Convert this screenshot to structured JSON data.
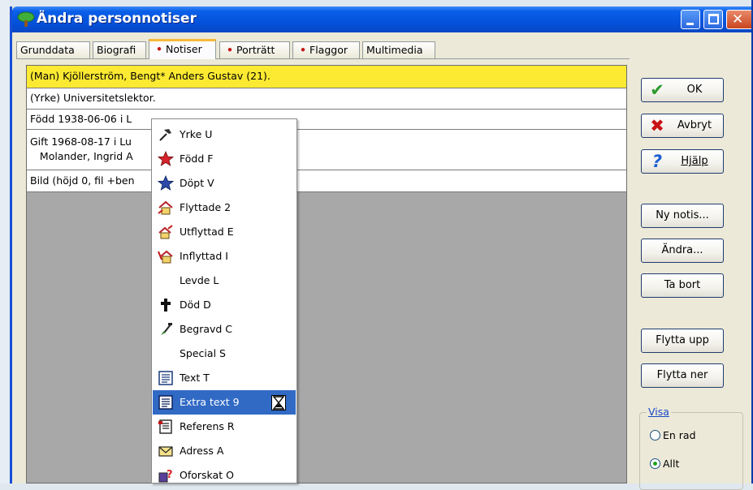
{
  "window": {
    "title": "Ändra personnotiser"
  },
  "tabs": [
    {
      "label": "Grunddata",
      "dot": false
    },
    {
      "label": "Biografi",
      "dot": false
    },
    {
      "label": "Notiser",
      "dot": true
    },
    {
      "label": "Porträtt",
      "dot": true
    },
    {
      "label": "Flaggor",
      "dot": true
    },
    {
      "label": "Multimedia",
      "dot": false
    }
  ],
  "active_tab": "Notiser",
  "notes": [
    {
      "text": "(Man) Kjöllerström, Bengt* Anders Gustav (21).",
      "selected": true
    },
    {
      "text": "(Yrke) Universitetslektor.",
      "selected": false
    },
    {
      "text": "Född 1938-06-06 i L",
      "selected": false
    },
    {
      "text": "Gift 1968-08-17 i Lu",
      "line2": "   Molander, Ingrid A",
      "selected": false
    },
    {
      "text": "Bild (höjd 0, fil +ben",
      "selected": false
    }
  ],
  "context_menu": {
    "items": [
      {
        "label": "Yrke U",
        "icon": "hammer-icon"
      },
      {
        "label": "Född F",
        "icon": "red-star-icon"
      },
      {
        "label": "Döpt V",
        "icon": "blue-star-icon"
      },
      {
        "label": "Flyttade 2",
        "icon": "house-move-icon"
      },
      {
        "label": "Utflyttad E",
        "icon": "house-out-icon"
      },
      {
        "label": "Inflyttad I",
        "icon": "house-in-icon"
      },
      {
        "label": "Levde L",
        "icon": ""
      },
      {
        "label": "Död D",
        "icon": "cross-icon"
      },
      {
        "label": "Begravd C",
        "icon": "shovel-icon"
      },
      {
        "label": "Special S",
        "icon": ""
      },
      {
        "label": "Text T",
        "icon": "text-doc-icon"
      },
      {
        "label": "Extra text 9",
        "icon": "text-doc-icon",
        "highlighted": true
      },
      {
        "label": "Referens R",
        "icon": "reference-doc-icon"
      },
      {
        "label": "Adress A",
        "icon": "envelope-icon"
      },
      {
        "label": "Oforskat O",
        "icon": "unresearched-icon"
      }
    ]
  },
  "buttons": {
    "ok": "OK",
    "cancel": "Avbryt",
    "help": "Hjälp",
    "new_note": "Ny notis...",
    "edit": "Ändra...",
    "delete": "Ta bort",
    "move_up": "Flytta upp",
    "move_down": "Flytta ner"
  },
  "visa": {
    "legend": "Visa",
    "options": [
      "En rad",
      "Allt"
    ],
    "selected": "Allt"
  },
  "colors": {
    "title_bar": "#0552dc",
    "selected_row": "#fcea32",
    "menu_highlight": "#316ac5",
    "active_tab_accent": "#f8b838"
  }
}
